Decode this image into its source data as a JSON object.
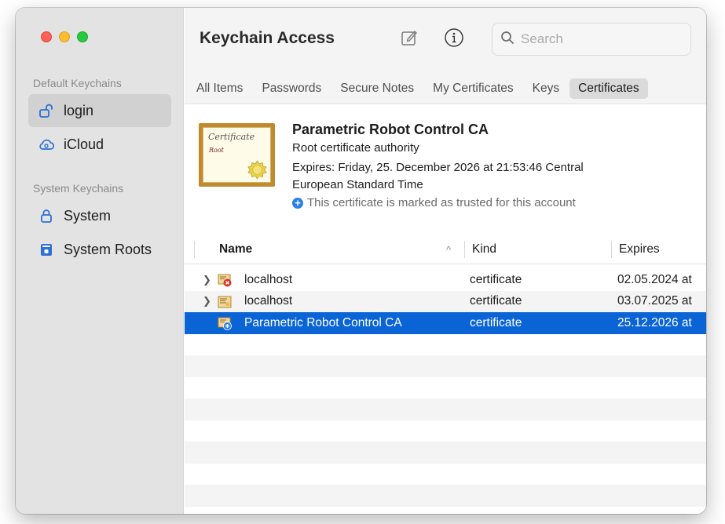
{
  "app": {
    "title": "Keychain Access"
  },
  "sidebar": {
    "default_section": "Default Keychains",
    "system_section": "System Keychains",
    "items": [
      {
        "label": "login",
        "icon": "unlocked-lock-icon",
        "selected": true
      },
      {
        "label": "iCloud",
        "icon": "icloud-icon",
        "selected": false
      },
      {
        "label": "System",
        "icon": "lock-icon",
        "selected": false
      },
      {
        "label": "System Roots",
        "icon": "cabinet-icon",
        "selected": false
      }
    ]
  },
  "toolbar": {
    "new_item_icon": "compose-icon",
    "info_icon": "info-icon",
    "search_placeholder": "Search"
  },
  "tabs": [
    {
      "label": "All Items",
      "selected": false
    },
    {
      "label": "Passwords",
      "selected": false
    },
    {
      "label": "Secure Notes",
      "selected": false
    },
    {
      "label": "My Certificates",
      "selected": false
    },
    {
      "label": "Keys",
      "selected": false
    },
    {
      "label": "Certificates",
      "selected": true
    }
  ],
  "certificate": {
    "image_text_1": "Certificate",
    "image_text_2": "Root",
    "name": "Parametric Robot Control CA",
    "subtitle": "Root certificate authority",
    "expires_line1": "Expires: Friday, 25. December 2026 at 21:53:46 Central",
    "expires_line2": "European Standard Time",
    "trust": "This certificate is marked as trusted for this account"
  },
  "table": {
    "columns": {
      "name": "Name",
      "kind": "Kind",
      "expires": "Expires"
    },
    "sort_indicator": "^",
    "rows": [
      {
        "name": "localhost",
        "kind": "certificate",
        "expires": "02.05.2024 at",
        "expandable": true,
        "status": "invalid"
      },
      {
        "name": "localhost",
        "kind": "certificate",
        "expires": "03.07.2025 at",
        "expandable": true,
        "status": "normal"
      },
      {
        "name": "Parametric Robot Control CA",
        "kind": "certificate",
        "expires": "25.12.2026 at",
        "expandable": false,
        "status": "trusted"
      }
    ]
  },
  "colors": {
    "selection": "#0a64d6",
    "trust_blue": "#2c7fe6",
    "invalid_red": "#d9352b"
  }
}
